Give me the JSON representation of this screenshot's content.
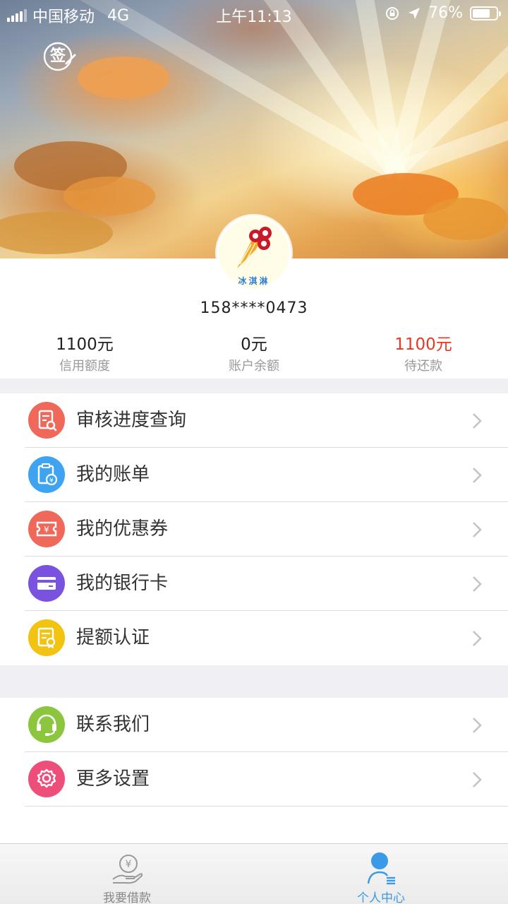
{
  "status_bar": {
    "carrier": "中国移动",
    "network": "4G",
    "time": "上午11:13",
    "battery_percent": "76%",
    "battery_level": 0.76
  },
  "header": {
    "sign_label": "签"
  },
  "profile": {
    "avatar_text": "冰淇淋",
    "phone": "158****0473",
    "stats": [
      {
        "value": "1100元",
        "label": "信用额度"
      },
      {
        "value": "0元",
        "label": "账户余额"
      },
      {
        "value": "1100元",
        "label": "待还款"
      }
    ]
  },
  "menu_main": [
    {
      "label": "审核进度查询",
      "icon": "review-progress-icon",
      "color": "#f0685a"
    },
    {
      "label": "我的账单",
      "icon": "bill-icon",
      "color": "#3ea4f2"
    },
    {
      "label": "我的优惠券",
      "icon": "coupon-icon",
      "color": "#f0685a"
    },
    {
      "label": "我的银行卡",
      "icon": "bank-card-icon",
      "color": "#7a52e0"
    },
    {
      "label": "提额认证",
      "icon": "credit-certification-icon",
      "color": "#f2c310"
    }
  ],
  "menu_secondary": [
    {
      "label": "联系我们",
      "icon": "headset-icon",
      "color": "#8cc63f"
    },
    {
      "label": "更多设置",
      "icon": "settings-gear-icon",
      "color": "#ee4f7a"
    }
  ],
  "tabbar": [
    {
      "label": "我要借款",
      "icon": "loan-hand-icon",
      "active": false
    },
    {
      "label": "个人中心",
      "icon": "person-center-icon",
      "active": true
    }
  ],
  "colors": {
    "accent_blue": "#3b9ae8",
    "due_red": "#e8381f",
    "page_bg": "#efeff4"
  }
}
